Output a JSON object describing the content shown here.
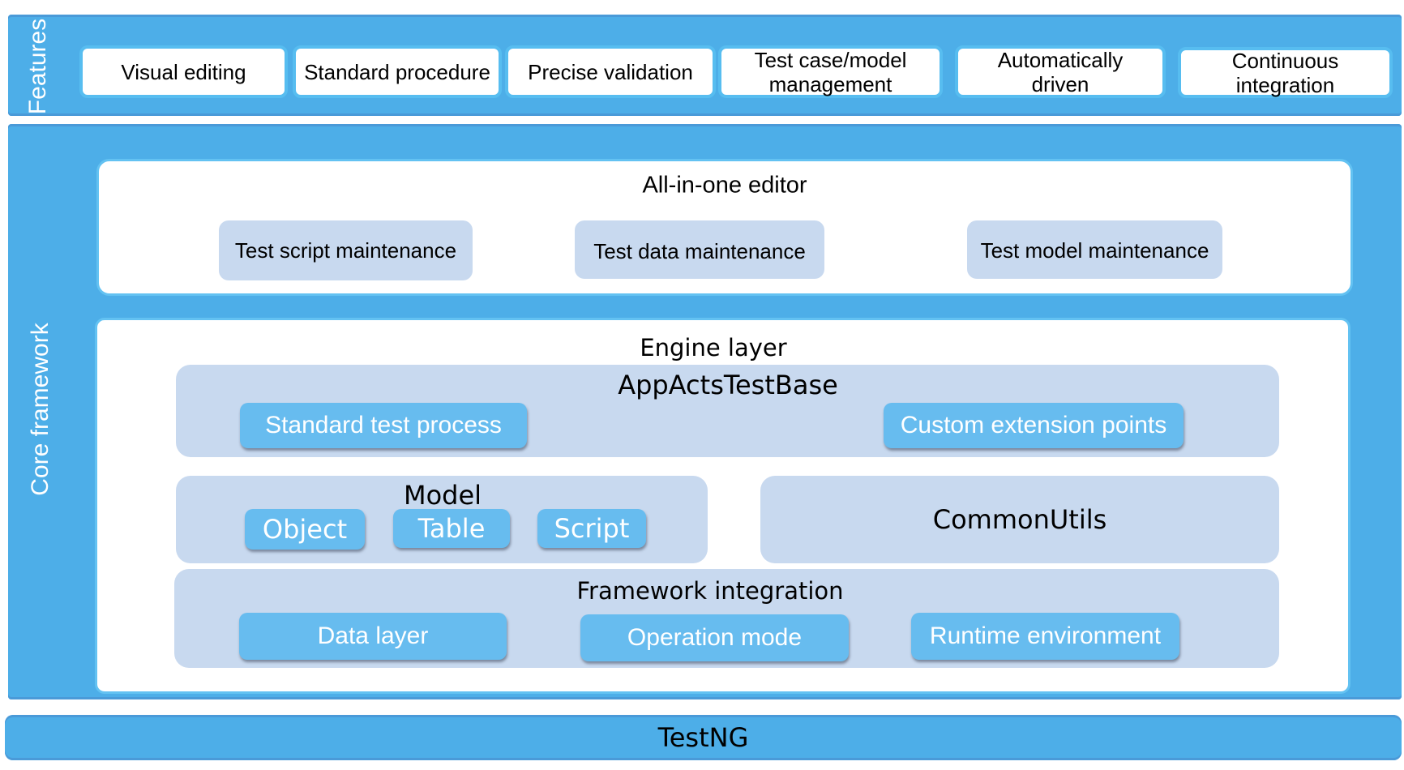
{
  "features": {
    "label": "Features",
    "items": [
      "Visual editing",
      "Standard procedure",
      "Precise validation",
      "Test case/model management",
      "Automatically driven",
      "Continuous integration"
    ]
  },
  "core": {
    "label": "Core framework",
    "editor": {
      "title": "All-in-one editor",
      "items": [
        "Test script maintenance",
        "Test data maintenance",
        "Test model maintenance"
      ]
    },
    "engine": {
      "title": "Engine layer",
      "base": {
        "title": "AppActsTestBase",
        "items": [
          "Standard test process",
          "Custom extension points"
        ]
      },
      "model": {
        "title": "Model",
        "items": [
          "Object",
          "Table",
          "Script"
        ]
      },
      "utils": {
        "title": "CommonUtils"
      },
      "integration": {
        "title": "Framework integration",
        "items": [
          "Data layer",
          "Operation mode",
          "Runtime environment"
        ]
      }
    }
  },
  "foundation": {
    "title": "TestNG"
  },
  "colors": {
    "panel_blue": "#4daee8",
    "button_blue": "#67bcef",
    "light_blue": "#c8d9ef",
    "white": "#ffffff"
  }
}
